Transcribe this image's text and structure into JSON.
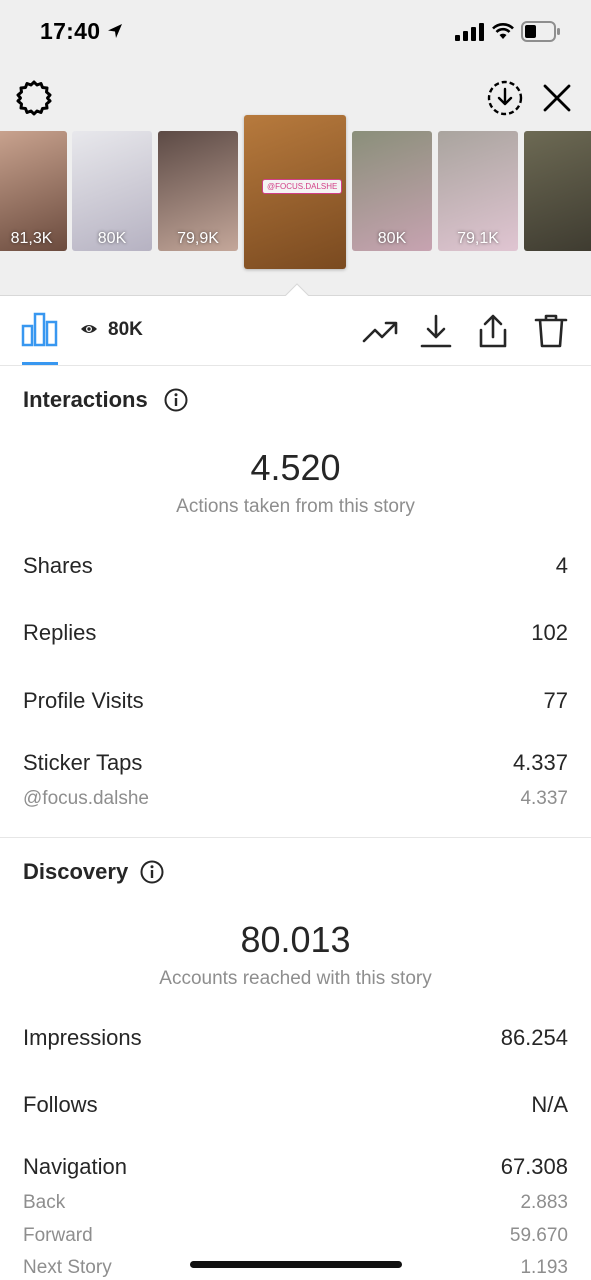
{
  "status_bar": {
    "time": "17:40"
  },
  "thumbnails": [
    {
      "views": "81,3K",
      "colors": [
        "#c9a38f",
        "#6b4b3e"
      ],
      "active": false
    },
    {
      "views": "80K",
      "colors": [
        "#e8e8ec",
        "#b6b2c2"
      ],
      "active": false
    },
    {
      "views": "79,9K",
      "colors": [
        "#5c4a45",
        "#c4a79a"
      ],
      "active": false
    },
    {
      "views": "",
      "colors": [
        "#b77a3d",
        "#7a4a20"
      ],
      "active": true,
      "tag": "@FOCUS.DALSHE"
    },
    {
      "views": "80K",
      "colors": [
        "#8a8f7a",
        "#c7a3b1"
      ],
      "active": false
    },
    {
      "views": "79,1K",
      "colors": [
        "#a9a49e",
        "#e0c5d2"
      ],
      "active": false
    },
    {
      "views": "",
      "colors": [
        "#6d6a54",
        "#3e3b30"
      ],
      "active": false
    }
  ],
  "toolbar": {
    "views": "80K"
  },
  "interactions": {
    "title": "Interactions",
    "total": "4.520",
    "caption": "Actions taken from this story",
    "rows": [
      {
        "label": "Shares",
        "value": "4"
      },
      {
        "label": "Replies",
        "value": "102"
      },
      {
        "label": "Profile Visits",
        "value": "77"
      },
      {
        "label": "Sticker Taps",
        "value": "4.337"
      }
    ],
    "sticker_sub": {
      "label": "@focus.dalshe",
      "value": "4.337"
    }
  },
  "discovery": {
    "title": "Discovery",
    "total": "80.013",
    "caption": "Accounts reached with this story",
    "rows": [
      {
        "label": "Impressions",
        "value": "86.254"
      },
      {
        "label": "Follows",
        "value": "N/A"
      },
      {
        "label": "Navigation",
        "value": "67.308"
      }
    ],
    "navigation_sub": [
      {
        "label": "Back",
        "value": "2.883"
      },
      {
        "label": "Forward",
        "value": "59.670"
      },
      {
        "label": "Next Story",
        "value": "1.193"
      }
    ]
  },
  "colors": {
    "accent": "#3897f0",
    "text": "#262626",
    "secondary": "#8e8e8e",
    "top_bg": "#efefef"
  }
}
